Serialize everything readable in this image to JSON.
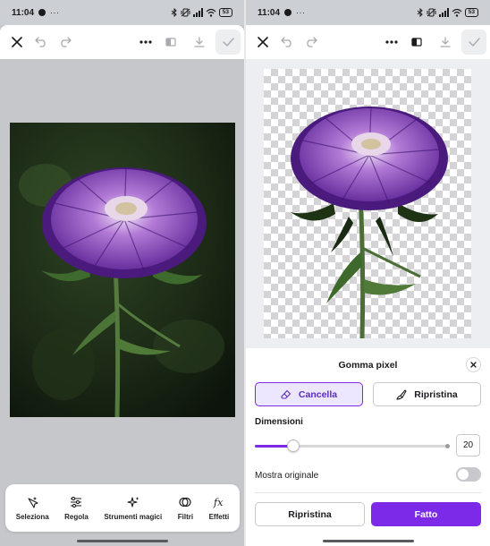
{
  "status_bar": {
    "time": "11:04",
    "more": "···",
    "battery": "53"
  },
  "bottom_tools": [
    {
      "label": "Seleziona",
      "icon": "sparkle-cursor-icon"
    },
    {
      "label": "Regola",
      "icon": "sliders-icon"
    },
    {
      "label": "Strumenti magici",
      "icon": "magic-sparkles-icon"
    },
    {
      "label": "Filtri",
      "icon": "filter-circles-icon"
    },
    {
      "label": "Effetti",
      "icon": "fx-icon"
    }
  ],
  "eraser_sheet": {
    "title": "Gomma pixel",
    "erase_label": "Cancella",
    "restore_label": "Ripristina",
    "size_label": "Dimensioni",
    "size_value": "20",
    "size_fraction": 0.2,
    "show_original_label": "Mostra originale",
    "show_original_on": false,
    "reset_label": "Ripristina",
    "done_label": "Fatto"
  },
  "colors": {
    "accent": "#7d2ae8",
    "accent_light": "#ede6ff",
    "canvas_gray": "#c6c7cb"
  }
}
